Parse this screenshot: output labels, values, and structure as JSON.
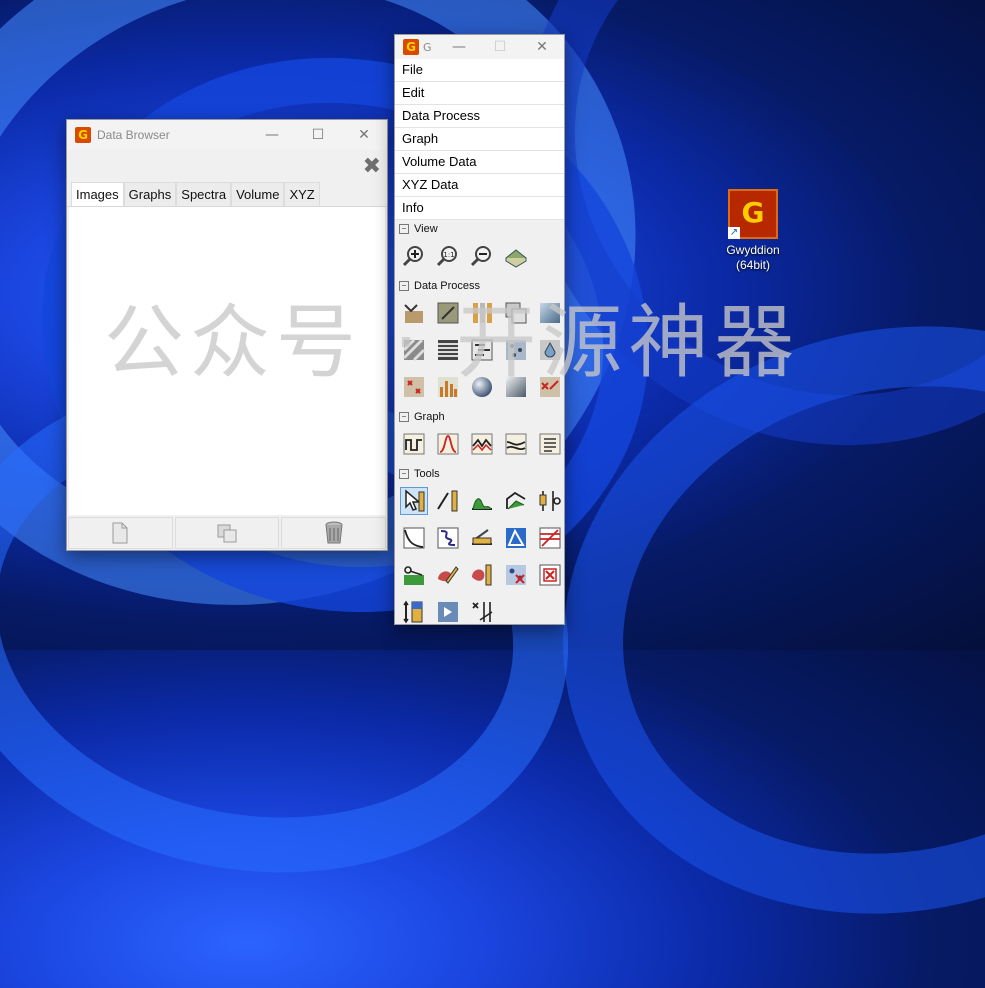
{
  "data_browser": {
    "title": "Data Browser",
    "tabs": [
      "Images",
      "Graphs",
      "Spectra",
      "Volume",
      "XYZ"
    ],
    "active_tab": "Images"
  },
  "gwyddion": {
    "title": "G",
    "menu": [
      "File",
      "Edit",
      "Data Process",
      "Graph",
      "Volume Data",
      "XYZ Data",
      "Info"
    ],
    "sections": {
      "view": "View",
      "data_process": "Data Process",
      "graph": "Graph",
      "tools": "Tools"
    }
  },
  "desktop_icon": {
    "label_line1": "Gwyddion",
    "label_line2": "(64bit)"
  },
  "watermark": "公众号 · 开源神器",
  "icons": {
    "view": [
      "zoom-in-icon",
      "zoom-1to1-icon",
      "zoom-out-icon",
      "3d-view-icon"
    ],
    "data_process": [
      "level-icon",
      "shade-icon",
      "profiles-icon",
      "scale-icon",
      "gradient-icon",
      "stripes-icon",
      "rows-icon",
      "filters-icon",
      "grains-icon",
      "particles-icon",
      "points-icon",
      "histogram-icon",
      "sphere-icon",
      "fft-icon",
      "mask-icon"
    ],
    "graph": [
      "graph-fit-icon",
      "graph-peak-icon",
      "graph-measure-icon",
      "graph-cut-icon",
      "graph-export-icon"
    ],
    "tools": [
      "pointer-tool-icon",
      "distance-tool-icon",
      "profile-tool-icon",
      "levels-tool-icon",
      "stats-tool-icon",
      "curve-tool-icon",
      "path-tool-icon",
      "spectro-tool-icon",
      "triangle-tool-icon",
      "lines-tool-icon",
      "crop-tool-icon",
      "mask-pencil-icon",
      "grain-tool-icon",
      "spot-remove-icon",
      "mask-remove-icon",
      "color-range-icon",
      "read-value-icon",
      "xy-correct-icon"
    ]
  }
}
